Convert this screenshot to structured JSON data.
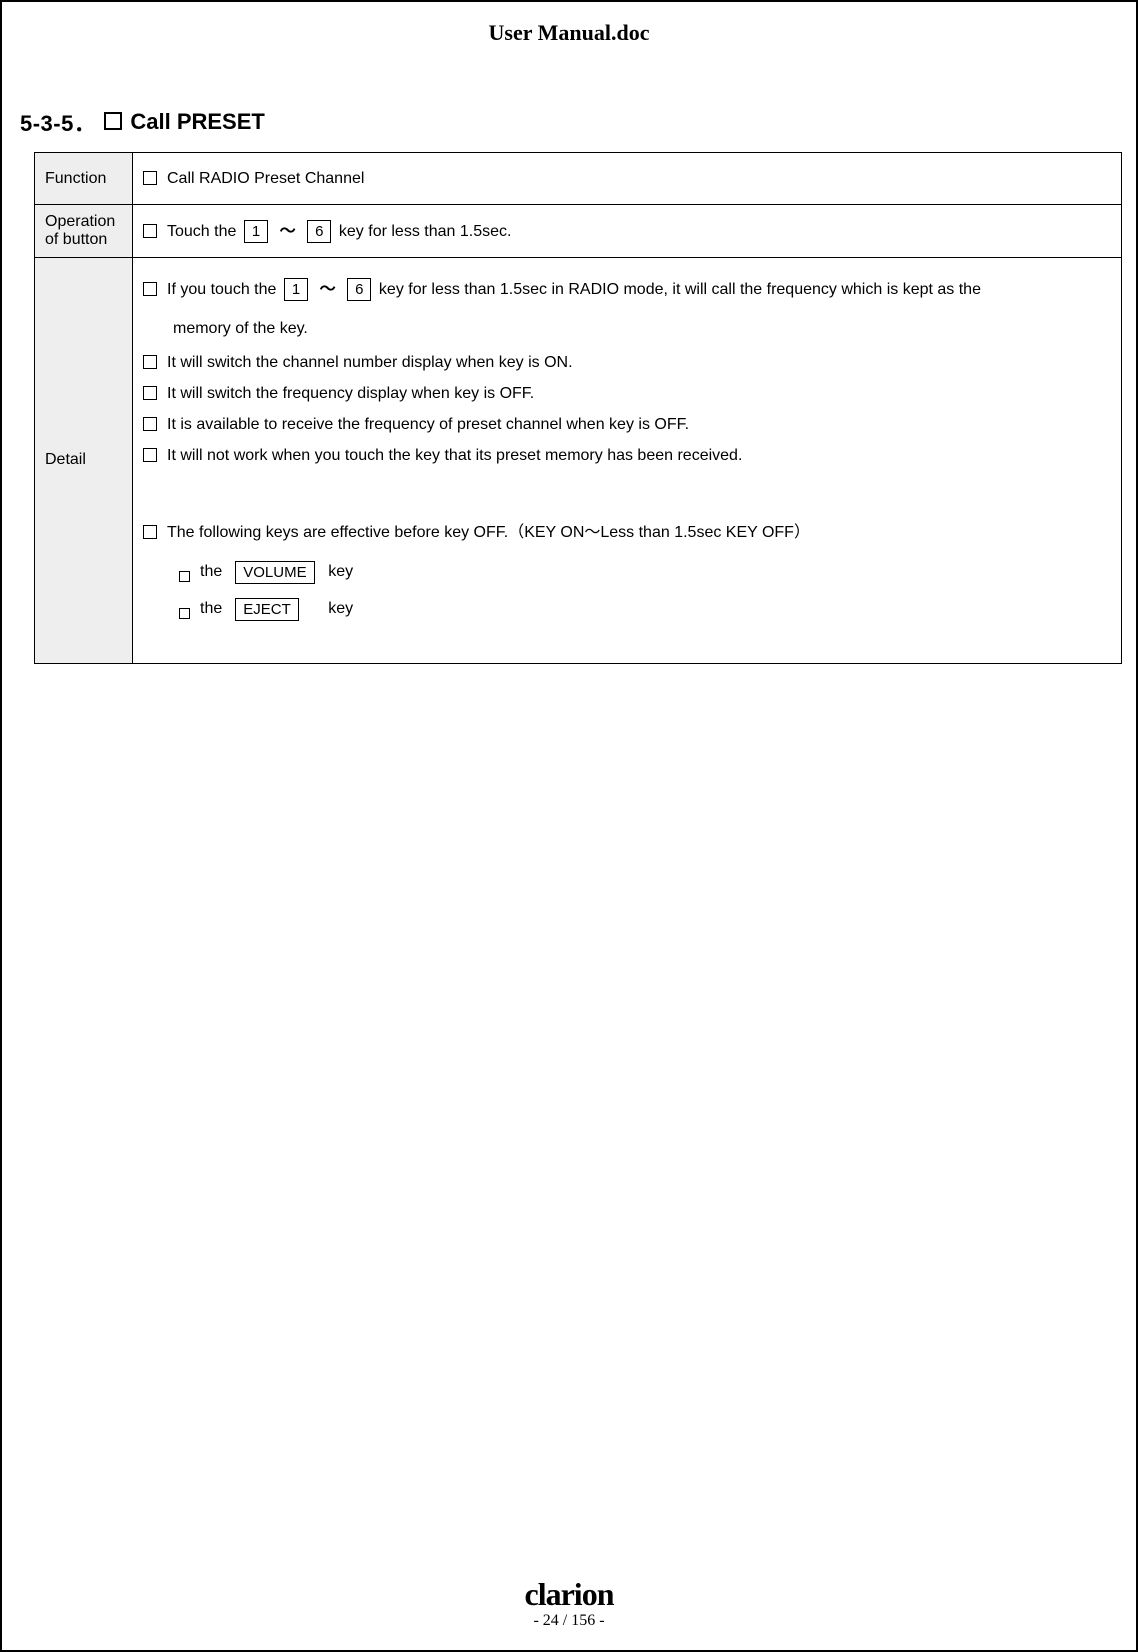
{
  "doc_title": "User Manual.doc",
  "section": {
    "number": "5-3-5．",
    "title": "Call PRESET"
  },
  "rows": {
    "function": {
      "label": "Function",
      "items": [
        {
          "text": "Call RADIO Preset Channel"
        }
      ]
    },
    "operation": {
      "label": "Operation of button",
      "prefix": "Touch the",
      "key_from": "1",
      "key_to": "6",
      "suffix": "key for less than 1.5sec."
    },
    "detail": {
      "label": "Detail",
      "line1": {
        "prefix": "If you touch the",
        "key_from": "1",
        "key_to": "6",
        "mid": "key for less than 1.5sec in RADIO mode, it will call the frequency which is kept as the",
        "continuation": "memory of the key."
      },
      "bullets": [
        "It will switch the channel number display when key is ON.",
        "It will switch the frequency display when key is OFF.",
        "It is available to receive the frequency of preset channel when key is OFF.",
        "It will not work when you touch the key that its preset memory has been received."
      ],
      "effective_line": "The following keys are effective before key OFF.（KEY ON～Less than 1.5sec KEY OFF）",
      "sub_bullets": [
        {
          "pre": "the",
          "keycap": "VOLUME",
          "post": "key"
        },
        {
          "pre": "the",
          "keycap": "EJECT",
          "post": "key"
        }
      ]
    }
  },
  "footer": {
    "logo": "clarion",
    "page": "- 24 / 156 -"
  }
}
